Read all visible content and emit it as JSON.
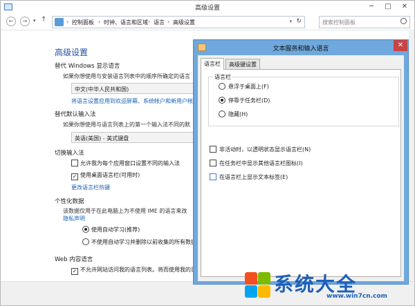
{
  "window": {
    "title": "高级设置",
    "min": "─",
    "max": "□",
    "close": "✕"
  },
  "nav": {
    "back": "←",
    "forward": "→",
    "up": "↑",
    "breadcrumbs": [
      "控制面板",
      "时钟、语言和区域",
      "语言",
      "高级设置"
    ],
    "sep": "›",
    "search_placeholder": "搜索控制面板"
  },
  "main": {
    "page_title": "高级设置",
    "sections": {
      "display_lang": {
        "heading": "替代 Windows 显示语言",
        "desc": "如果你想使用与安装语言列表中的顺序所确定的语言",
        "value": "中文(中华人民共和国)",
        "link": "将语言设置应用到欢迎屏幕、系统帐户和新用户帐户"
      },
      "input_method": {
        "heading": "替代默认输入法",
        "desc": "如果你想使用与语言列表上的第一个输入法不同的默",
        "value": "英语(美国) - 美式键盘"
      },
      "switching": {
        "heading": "切换输入法",
        "chk1": "允许我为每个应用窗口设置不同的输入法",
        "chk2": "使用桌面语言栏(可用时)",
        "link": "更改语言栏热键"
      },
      "personalization": {
        "heading": "个性化数据",
        "desc": "该数据仅用于在此电脑上为不使用 IME 的语言来改",
        "link": "隐私声明",
        "radio1": "使用自动学习(推荐)",
        "radio2": "不使用自动学习并删除以前收集的所有数据"
      },
      "web": {
        "heading": "Web 内容语言",
        "chk": "不允许网站访问我的语言列表。将而使用我的日期"
      }
    }
  },
  "dialog": {
    "title": "文本服务和输入语言",
    "close": "✕",
    "tabs": [
      "语言栏",
      "高级键设置"
    ],
    "group_label": "语言栏",
    "radios": [
      "悬浮于桌面上(F)",
      "停靠于任务栏(D)",
      "隐藏(H)"
    ],
    "checks": [
      "非活动时，以透明状态显示语言栏(N)",
      "在任务栏中显示其他语言栏图标(I)",
      "在语言栏上显示文本标签(E)"
    ]
  },
  "watermark": {
    "brand": "系统大全",
    "url": "www.win7cn.com"
  },
  "colors": {
    "dialog_frame": "#6fa8dc",
    "link": "#1a5fb4",
    "close_red": "#c94343",
    "watermark": "#1c5fb8"
  }
}
